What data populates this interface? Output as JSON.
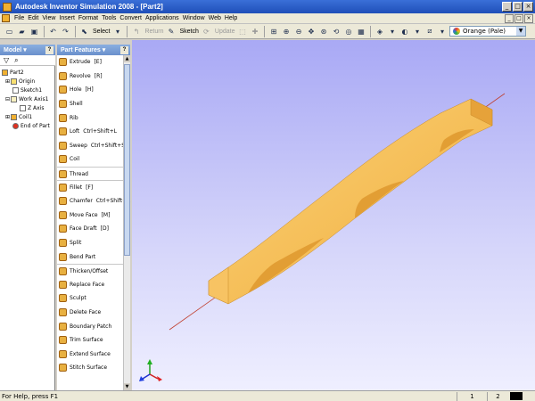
{
  "window": {
    "title": "Autodesk Inventor Simulation 2008 - [Part2]",
    "controls": [
      "_",
      "□",
      "×"
    ]
  },
  "menu": {
    "items": [
      "File",
      "Edit",
      "View",
      "Insert",
      "Format",
      "Tools",
      "Convert",
      "Applications",
      "Window",
      "Web",
      "Help"
    ]
  },
  "toolbar": {
    "select_label": "Select",
    "return_label": "Return",
    "sketch_label": "Sketch",
    "update_label": "Update",
    "color_value": "Orange (Pale)"
  },
  "model_panel": {
    "title": "Model",
    "tree": [
      {
        "label": "Part2",
        "icon": "part-icon"
      },
      {
        "label": "Origin",
        "icon": "folder-icon"
      },
      {
        "label": "Sketch1",
        "icon": "sketch-icon"
      },
      {
        "label": "Work Axis1",
        "icon": "work-axis-icon"
      },
      {
        "label": "Z Axis",
        "icon": "axis-icon"
      },
      {
        "label": "Coil1",
        "icon": "coil-icon"
      },
      {
        "label": "End of Part",
        "icon": "end-of-part-icon"
      }
    ]
  },
  "features_panel": {
    "title": "Part Features",
    "items": [
      {
        "label": "Extrude",
        "shortcut": "[E]"
      },
      {
        "label": "Revolve",
        "shortcut": "[R]"
      },
      {
        "label": "Hole",
        "shortcut": "[H]"
      },
      {
        "label": "Shell",
        "shortcut": ""
      },
      {
        "label": "Rib",
        "shortcut": ""
      },
      {
        "label": "Loft",
        "shortcut": "Ctrl+Shift+L"
      },
      {
        "label": "Sweep",
        "shortcut": "Ctrl+Shift+S"
      },
      {
        "label": "Coil",
        "shortcut": ""
      },
      {
        "label": "Thread",
        "shortcut": ""
      },
      {
        "label": "Fillet",
        "shortcut": "[F]"
      },
      {
        "label": "Chamfer",
        "shortcut": "Ctrl+Shift+K"
      },
      {
        "label": "Move Face",
        "shortcut": "[M]"
      },
      {
        "label": "Face Draft",
        "shortcut": "[D]"
      },
      {
        "label": "Split",
        "shortcut": ""
      },
      {
        "label": "Bend Part",
        "shortcut": ""
      },
      {
        "label": "Thicken/Offset",
        "shortcut": ""
      },
      {
        "label": "Replace Face",
        "shortcut": ""
      },
      {
        "label": "Sculpt",
        "shortcut": ""
      },
      {
        "label": "Delete Face",
        "shortcut": ""
      },
      {
        "label": "Boundary Patch",
        "shortcut": ""
      },
      {
        "label": "Trim Surface",
        "shortcut": ""
      },
      {
        "label": "Extend Surface",
        "shortcut": ""
      },
      {
        "label": "Stitch Surface",
        "shortcut": ""
      }
    ]
  },
  "status": {
    "help_text": "For Help, press F1",
    "cell1": "1",
    "cell2": "2"
  },
  "colors": {
    "viewport_top": "#a9a9f5",
    "viewport_bottom": "#efefff",
    "part": "#f4b74a",
    "axis_line": "#c04030"
  }
}
